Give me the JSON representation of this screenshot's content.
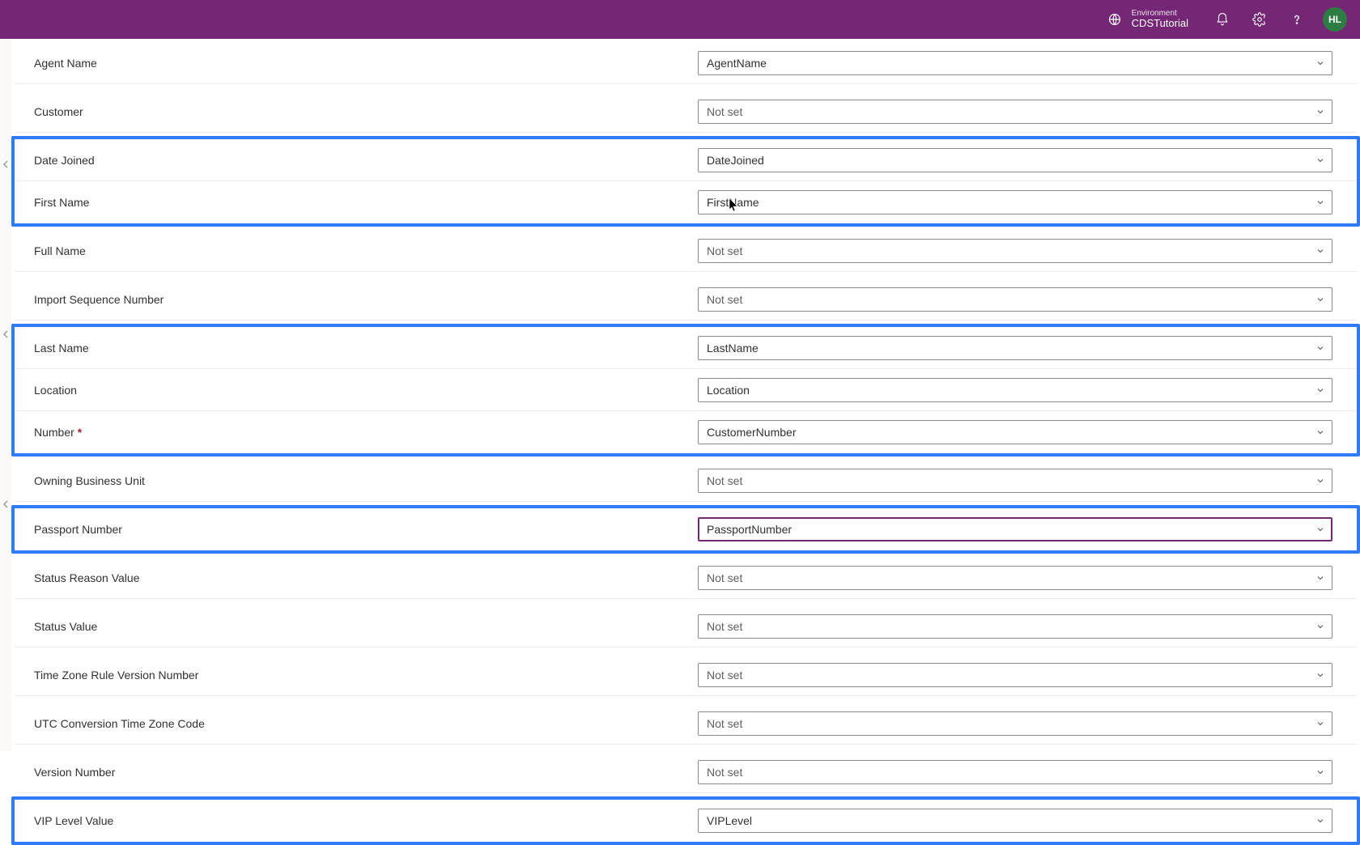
{
  "header": {
    "environment_label": "Environment",
    "environment_name": "CDSTutorial",
    "avatar_initials": "HL"
  },
  "rows": [
    {
      "label": "Agent Name",
      "value": "AgentName",
      "notset": false,
      "highlightGroup": null,
      "focused": false
    },
    {
      "label": "Customer",
      "value": "Not set",
      "notset": true,
      "highlightGroup": null,
      "focused": false
    },
    {
      "label": "Date Joined",
      "value": "DateJoined",
      "notset": false,
      "highlightGroup": 1,
      "focused": false
    },
    {
      "label": "First Name",
      "value": "FirstName",
      "notset": false,
      "highlightGroup": 1,
      "focused": false
    },
    {
      "label": "Full Name",
      "value": "Not set",
      "notset": true,
      "highlightGroup": null,
      "focused": false
    },
    {
      "label": "Import Sequence Number",
      "value": "Not set",
      "notset": true,
      "highlightGroup": null,
      "focused": false
    },
    {
      "label": "Last Name",
      "value": "LastName",
      "notset": false,
      "highlightGroup": 2,
      "focused": false
    },
    {
      "label": "Location",
      "value": "Location",
      "notset": false,
      "highlightGroup": 2,
      "focused": false
    },
    {
      "label": "Number",
      "value": "CustomerNumber",
      "notset": false,
      "highlightGroup": 2,
      "focused": false,
      "required": true
    },
    {
      "label": "Owning Business Unit",
      "value": "Not set",
      "notset": true,
      "highlightGroup": null,
      "focused": false
    },
    {
      "label": "Passport Number",
      "value": "PassportNumber",
      "notset": false,
      "highlightGroup": 3,
      "focused": true
    },
    {
      "label": "Status Reason Value",
      "value": "Not set",
      "notset": true,
      "highlightGroup": null,
      "focused": false
    },
    {
      "label": "Status Value",
      "value": "Not set",
      "notset": true,
      "highlightGroup": null,
      "focused": false
    },
    {
      "label": "Time Zone Rule Version Number",
      "value": "Not set",
      "notset": true,
      "highlightGroup": null,
      "focused": false
    },
    {
      "label": "UTC Conversion Time Zone Code",
      "value": "Not set",
      "notset": true,
      "highlightGroup": null,
      "focused": false
    },
    {
      "label": "Version Number",
      "value": "Not set",
      "notset": true,
      "highlightGroup": null,
      "focused": false
    },
    {
      "label": "VIP Level Value",
      "value": "VIPLevel",
      "notset": false,
      "highlightGroup": 4,
      "focused": false
    }
  ]
}
